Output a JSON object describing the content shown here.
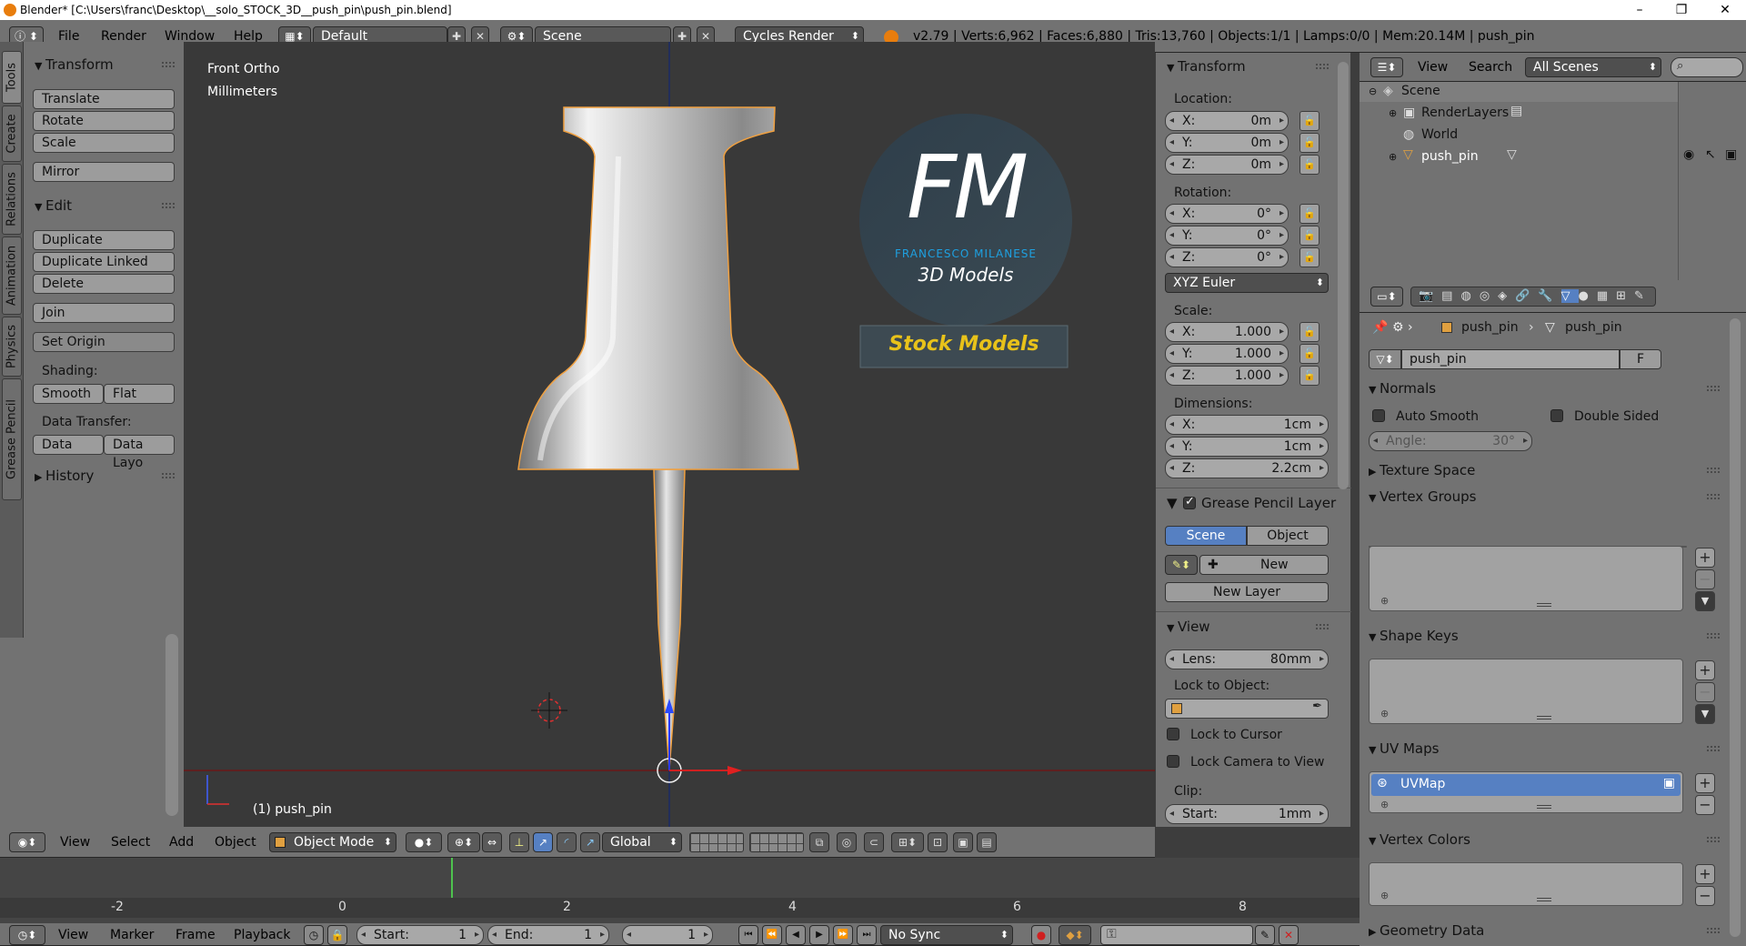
{
  "titlebar": {
    "title": "Blender* [C:\\Users\\franc\\Desktop\\__solo_STOCK_3D__push_pin\\push_pin.blend]",
    "minimize": "–",
    "maximize": "❐",
    "close": "✕"
  },
  "infobar": {
    "menus": [
      "File",
      "Render",
      "Window",
      "Help"
    ],
    "layout": "Default",
    "scene": "Scene",
    "engine": "Cycles Render",
    "stats": "v2.79 | Verts:6,962 | Faces:6,880 | Tris:13,760 | Objects:1/1 | Lamps:0/0 | Mem:20.14M | push_pin"
  },
  "tooltabs": [
    "Tools",
    "Create",
    "Relations",
    "Animation",
    "Physics",
    "Grease Pencil"
  ],
  "toolshelf": {
    "transform_title": "Transform",
    "translate": "Translate",
    "rotate": "Rotate",
    "scale": "Scale",
    "mirror": "Mirror",
    "edit_title": "Edit",
    "duplicate": "Duplicate",
    "duplicate_linked": "Duplicate Linked",
    "delete": "Delete",
    "join": "Join",
    "set_origin": "Set Origin",
    "shading_label": "Shading:",
    "smooth": "Smooth",
    "flat": "Flat",
    "data_transfer_label": "Data Transfer:",
    "data": "Data",
    "data_layo": "Data Layo",
    "history_title": "History"
  },
  "viewport": {
    "view_name": "Front Ortho",
    "units": "Millimeters",
    "object_label": "(1) push_pin",
    "logo_letters": "FM",
    "logo_name": "FRANCESCO MILANESE",
    "logo_sub": "3D Models",
    "logo_banner": "Stock Models"
  },
  "viewport_header": {
    "view": "View",
    "select": "Select",
    "add": "Add",
    "object": "Object",
    "mode": "Object Mode",
    "orientation": "Global"
  },
  "npanel": {
    "transform_title": "Transform",
    "location_label": "Location:",
    "location": [
      {
        "k": "X:",
        "v": "0m"
      },
      {
        "k": "Y:",
        "v": "0m"
      },
      {
        "k": "Z:",
        "v": "0m"
      }
    ],
    "rotation_label": "Rotation:",
    "rotation": [
      {
        "k": "X:",
        "v": "0°"
      },
      {
        "k": "Y:",
        "v": "0°"
      },
      {
        "k": "Z:",
        "v": "0°"
      }
    ],
    "rotation_mode": "XYZ Euler",
    "scale_label": "Scale:",
    "scale": [
      {
        "k": "X:",
        "v": "1.000"
      },
      {
        "k": "Y:",
        "v": "1.000"
      },
      {
        "k": "Z:",
        "v": "1.000"
      }
    ],
    "dimensions_label": "Dimensions:",
    "dimensions": [
      {
        "k": "X:",
        "v": "1cm"
      },
      {
        "k": "Y:",
        "v": "1cm"
      },
      {
        "k": "Z:",
        "v": "2.2cm"
      }
    ],
    "grease_title": "Grease Pencil Layer",
    "scene_tab": "Scene",
    "object_tab": "Object",
    "new": "New",
    "new_layer": "New Layer",
    "view_title": "View",
    "lens_label": "Lens:",
    "lens_value": "80mm",
    "lock_to_object": "Lock to Object:",
    "lock_to_cursor": "Lock to Cursor",
    "lock_camera": "Lock Camera to View",
    "clip_label": "Clip:",
    "clip_start_label": "Start:",
    "clip_start_value": "1mm"
  },
  "outliner": {
    "view": "View",
    "search": "Search",
    "filter": "All Scenes",
    "items": [
      "Scene",
      "RenderLayers",
      "World",
      "push_pin"
    ]
  },
  "properties": {
    "crumb_obj": "push_pin",
    "crumb_mesh": "push_pin",
    "mesh_name": "push_pin",
    "fake_user": "F",
    "normals_title": "Normals",
    "auto_smooth": "Auto Smooth",
    "double_sided": "Double Sided",
    "angle_label": "Angle:",
    "angle_value": "30°",
    "texture_space": "Texture Space",
    "vertex_groups": "Vertex Groups",
    "shape_keys": "Shape Keys",
    "uv_maps": "UV Maps",
    "uvmap_item": "UVMap",
    "vertex_colors": "Vertex Colors",
    "geometry_data": "Geometry Data"
  },
  "timeline": {
    "ticks": [
      "-2",
      "0",
      "2",
      "4",
      "6",
      "8"
    ],
    "view": "View",
    "marker": "Marker",
    "frame": "Frame",
    "playback": "Playback",
    "start_label": "Start:",
    "start_value": "1",
    "end_label": "End:",
    "end_value": "1",
    "current": "1",
    "sync": "No Sync"
  },
  "colors": {
    "ui_gray": "#727272",
    "viewport_bg": "#393939",
    "selection_orange": "#f0a040",
    "active_blue": "#5680c2",
    "logo_blue": "#1ea0e0",
    "banner_yellow": "#e8c21a"
  }
}
